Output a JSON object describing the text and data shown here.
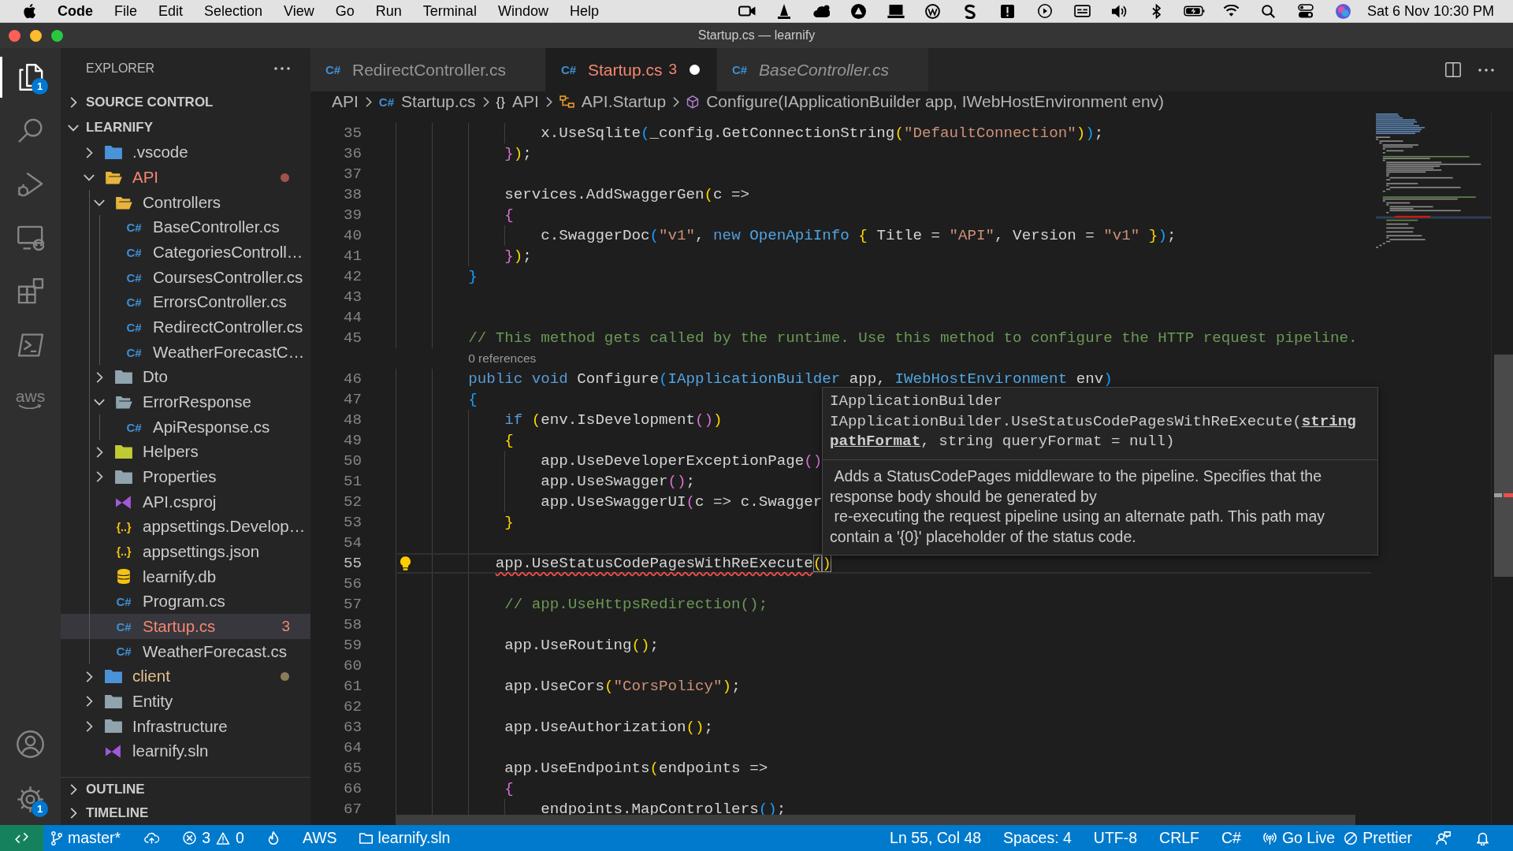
{
  "menu_bar": {
    "app": "Code",
    "menus": [
      "File",
      "Edit",
      "Selection",
      "View",
      "Go",
      "Run",
      "Terminal",
      "Window",
      "Help"
    ],
    "clock": "Sat 6 Nov 10:30 PM"
  },
  "window": {
    "title": "Startup.cs — learnify"
  },
  "activity_bar": {
    "items": [
      {
        "selected": true,
        "badge": "1"
      },
      {
        "selected": false
      },
      {
        "selected": false
      },
      {
        "selected": false
      },
      {
        "selected": false
      },
      {
        "selected": false
      },
      {
        "selected": false,
        "label": "aws"
      }
    ],
    "manage": {
      "badge": "1"
    }
  },
  "sidebar": {
    "title": "EXPLORER",
    "sections": [
      {
        "label": "SOURCE CONTROL",
        "expanded": false
      },
      {
        "label": "LEARNIFY",
        "expanded": true,
        "tree": [
          {
            "kind": "folder",
            "label": ".vscode",
            "color": "#4b93d8",
            "expanded": false,
            "selected": false,
            "errors": false,
            "modified": false
          },
          {
            "kind": "folder",
            "label": "API",
            "color": "#e9b43c",
            "expanded": true,
            "selected": false,
            "errors": true,
            "modified": false,
            "children": [
              {
                "kind": "folder",
                "label": "Controllers",
                "color": "#e9b43c",
                "expanded": true,
                "selected": false,
                "errors": false,
                "modified": false,
                "children": [
                  {
                    "kind": "csharp-file",
                    "glyph": "C#",
                    "label": "BaseController.cs",
                    "color": "#3f8fd2",
                    "selected": false,
                    "errors": false,
                    "modified": false
                  },
                  {
                    "kind": "csharp-file",
                    "glyph": "C#",
                    "label": "CategoriesControll…",
                    "color": "#3f8fd2",
                    "selected": false,
                    "errors": false,
                    "modified": false
                  },
                  {
                    "kind": "csharp-file",
                    "glyph": "C#",
                    "label": "CoursesController.cs",
                    "color": "#3f8fd2",
                    "selected": false,
                    "errors": false,
                    "modified": false
                  },
                  {
                    "kind": "csharp-file",
                    "glyph": "C#",
                    "label": "ErrorsController.cs",
                    "color": "#3f8fd2",
                    "selected": false,
                    "errors": false,
                    "modified": false
                  },
                  {
                    "kind": "csharp-file",
                    "glyph": "C#",
                    "label": "RedirectController.cs",
                    "color": "#3f8fd2",
                    "selected": false,
                    "errors": false,
                    "modified": false
                  },
                  {
                    "kind": "csharp-file",
                    "glyph": "C#",
                    "label": "WeatherForecastC…",
                    "color": "#3f8fd2",
                    "selected": false,
                    "errors": false,
                    "modified": false
                  }
                ]
              },
              {
                "kind": "folder",
                "label": "Dto",
                "color": "#90a4ae",
                "expanded": false,
                "selected": false,
                "errors": false,
                "modified": false
              },
              {
                "kind": "folder",
                "label": "ErrorResponse",
                "color": "#90a4ae",
                "expanded": true,
                "selected": false,
                "errors": false,
                "modified": false,
                "children": [
                  {
                    "kind": "csharp-file",
                    "glyph": "C#",
                    "label": "ApiResponse.cs",
                    "color": "#3f8fd2",
                    "selected": false,
                    "errors": false,
                    "modified": false
                  }
                ]
              },
              {
                "kind": "folder",
                "label": "Helpers",
                "color": "#c0ca33",
                "expanded": false,
                "selected": false,
                "errors": false,
                "modified": false
              },
              {
                "kind": "folder",
                "label": "Properties",
                "color": "#90a4ae",
                "expanded": false,
                "selected": false,
                "errors": false,
                "modified": false
              },
              {
                "kind": "vs-file",
                "label": "API.csproj",
                "color": "#a259d9",
                "selected": false,
                "errors": false,
                "modified": false
              },
              {
                "kind": "json-file",
                "glyph": "{..}",
                "label": "appsettings.Develop…",
                "color": "#f5c211",
                "selected": false,
                "errors": false,
                "modified": false
              },
              {
                "kind": "json-file",
                "glyph": "{..}",
                "label": "appsettings.json",
                "color": "#f5c211",
                "selected": false,
                "errors": false,
                "modified": false
              },
              {
                "kind": "db-file",
                "label": "learnify.db",
                "color": "#f5c211",
                "selected": false,
                "errors": false,
                "modified": false
              },
              {
                "kind": "csharp-file",
                "glyph": "C#",
                "label": "Program.cs",
                "color": "#3f8fd2",
                "selected": false,
                "errors": false,
                "modified": false
              },
              {
                "kind": "csharp-file",
                "glyph": "C#",
                "label": "Startup.cs",
                "color": "#3f8fd2",
                "selected": true,
                "errors": true,
                "modified": false,
                "badge": "3"
              },
              {
                "kind": "csharp-file",
                "glyph": "C#",
                "label": "WeatherForecast.cs",
                "color": "#3f8fd2",
                "selected": false,
                "errors": false,
                "modified": false
              }
            ]
          },
          {
            "kind": "folder",
            "label": "client",
            "color": "#4b93d8",
            "expanded": false,
            "selected": false,
            "errors": false,
            "modified": true
          },
          {
            "kind": "folder",
            "label": "Entity",
            "color": "#90a4ae",
            "expanded": false,
            "selected": false,
            "errors": false,
            "modified": false
          },
          {
            "kind": "folder",
            "label": "Infrastructure",
            "color": "#90a4ae",
            "expanded": false,
            "selected": false,
            "errors": false,
            "modified": false
          },
          {
            "kind": "vs-file",
            "label": "learnify.sln",
            "color": "#a259d9",
            "selected": false,
            "errors": false,
            "modified": false
          }
        ]
      },
      {
        "label": "OUTLINE",
        "expanded": false
      },
      {
        "label": "TIMELINE",
        "expanded": false
      }
    ]
  },
  "editor": {
    "tabs": [
      {
        "glyph": "C#",
        "label": "RedirectController.cs",
        "selected": false,
        "dirty": false,
        "preview": false,
        "errors": false
      },
      {
        "glyph": "C#",
        "label": "Startup.cs",
        "badge": "3",
        "selected": true,
        "dirty": true,
        "preview": false,
        "errors": true
      },
      {
        "glyph": "C#",
        "label": "BaseController.cs",
        "selected": false,
        "dirty": false,
        "preview": true,
        "errors": false
      }
    ],
    "breadcrumb": [
      {
        "kind": "folder",
        "label": "API"
      },
      {
        "kind": "csharp-file",
        "glyph": "C#",
        "label": "Startup.cs"
      },
      {
        "kind": "namespace",
        "glyph": "{}",
        "label": "API"
      },
      {
        "kind": "class",
        "label": "API.Startup"
      },
      {
        "kind": "method",
        "label": "Configure(IApplicationBuilder app, IWebHostEnvironment env)"
      }
    ],
    "lines": [
      {
        "kind": "code",
        "number": "35",
        "current": false,
        "lightbulb": false,
        "tokens": [
          {
            "kind": "plain",
            "text": "                x.UseSqlite"
          },
          {
            "kind": "bracket-3",
            "text": "("
          },
          {
            "kind": "plain",
            "text": "_config.GetConnectionString"
          },
          {
            "kind": "bracket-1",
            "text": "("
          },
          {
            "kind": "string",
            "text": "\"DefaultConnection\""
          },
          {
            "kind": "bracket-1",
            "text": ")"
          },
          {
            "kind": "bracket-3",
            "text": ")"
          },
          {
            "kind": "plain",
            "text": ";"
          }
        ]
      },
      {
        "kind": "code",
        "number": "36",
        "current": false,
        "lightbulb": false,
        "tokens": [
          {
            "kind": "bracket-2",
            "text": "            }"
          },
          {
            "kind": "bracket-1",
            "text": ")"
          },
          {
            "kind": "plain",
            "text": ";"
          }
        ]
      },
      {
        "kind": "code",
        "number": "37",
        "current": false,
        "lightbulb": false
      },
      {
        "kind": "code",
        "number": "38",
        "current": false,
        "lightbulb": false,
        "tokens": [
          {
            "kind": "plain",
            "text": "            services.AddSwaggerGen"
          },
          {
            "kind": "bracket-1",
            "text": "("
          },
          {
            "kind": "plain",
            "text": "c =>"
          }
        ]
      },
      {
        "kind": "code",
        "number": "39",
        "current": false,
        "lightbulb": false,
        "tokens": [
          {
            "kind": "bracket-2",
            "text": "            {"
          }
        ]
      },
      {
        "kind": "code",
        "number": "40",
        "current": false,
        "lightbulb": false,
        "tokens": [
          {
            "kind": "plain",
            "text": "                c.SwaggerDoc"
          },
          {
            "kind": "bracket-3",
            "text": "("
          },
          {
            "kind": "string",
            "text": "\"v1\""
          },
          {
            "kind": "plain",
            "text": ", "
          },
          {
            "kind": "keyword",
            "text": "new"
          },
          {
            "kind": "type",
            "text": " OpenApiInfo"
          },
          {
            "kind": "bracket-1",
            "text": " {"
          },
          {
            "kind": "plain",
            "text": " Title = "
          },
          {
            "kind": "string",
            "text": "\"API\""
          },
          {
            "kind": "plain",
            "text": ", Version = "
          },
          {
            "kind": "string",
            "text": "\"v1\""
          },
          {
            "kind": "bracket-1",
            "text": " }"
          },
          {
            "kind": "bracket-3",
            "text": ")"
          },
          {
            "kind": "plain",
            "text": ";"
          }
        ]
      },
      {
        "kind": "code",
        "number": "41",
        "current": false,
        "lightbulb": false,
        "tokens": [
          {
            "kind": "bracket-2",
            "text": "            }"
          },
          {
            "kind": "bracket-1",
            "text": ")"
          },
          {
            "kind": "plain",
            "text": ";"
          }
        ]
      },
      {
        "kind": "code",
        "number": "42",
        "current": false,
        "lightbulb": false,
        "tokens": [
          {
            "kind": "bracket-3",
            "text": "        }"
          }
        ]
      },
      {
        "kind": "code",
        "number": "43",
        "current": false,
        "lightbulb": false
      },
      {
        "kind": "code",
        "number": "44",
        "current": false,
        "lightbulb": false
      },
      {
        "kind": "code",
        "number": "45",
        "current": false,
        "lightbulb": false,
        "tokens": [
          {
            "kind": "comment",
            "text": "        // This method gets called by the runtime. Use this method to configure the HTTP request pipeline."
          }
        ]
      },
      {
        "kind": "codelens",
        "text": "0 references"
      },
      {
        "kind": "code",
        "number": "46",
        "current": false,
        "lightbulb": false,
        "tokens": [
          {
            "kind": "keyword",
            "text": "        public void"
          },
          {
            "kind": "plain",
            "text": " Configure"
          },
          {
            "kind": "bracket-3",
            "text": "("
          },
          {
            "kind": "type",
            "text": "IApplicationBuilder"
          },
          {
            "kind": "plain",
            "text": " app, "
          },
          {
            "kind": "type",
            "text": "IWebHostEnvironment"
          },
          {
            "kind": "plain",
            "text": " env"
          },
          {
            "kind": "bracket-3",
            "text": ")"
          }
        ]
      },
      {
        "kind": "code",
        "number": "47",
        "current": false,
        "lightbulb": false,
        "tokens": [
          {
            "kind": "bracket-3",
            "text": "        {"
          }
        ]
      },
      {
        "kind": "code",
        "number": "48",
        "current": false,
        "lightbulb": false,
        "tokens": [
          {
            "kind": "keyword",
            "text": "            if"
          },
          {
            "kind": "bracket-1",
            "text": " ("
          },
          {
            "kind": "plain",
            "text": "env.IsDevelopment"
          },
          {
            "kind": "bracket-2",
            "text": "("
          },
          {
            "kind": "bracket-2",
            "text": ")"
          },
          {
            "kind": "bracket-1",
            "text": ")"
          }
        ]
      },
      {
        "kind": "code",
        "number": "49",
        "current": false,
        "lightbulb": false,
        "tokens": [
          {
            "kind": "bracket-1",
            "text": "            {"
          }
        ]
      },
      {
        "kind": "code",
        "number": "50",
        "current": false,
        "lightbulb": false,
        "tokens": [
          {
            "kind": "plain",
            "text": "                app.UseDeveloperExceptionPage"
          },
          {
            "kind": "bracket-2",
            "text": "("
          },
          {
            "kind": "bracket-2",
            "text": ")"
          }
        ]
      },
      {
        "kind": "code",
        "number": "51",
        "current": false,
        "lightbulb": false,
        "tokens": [
          {
            "kind": "plain",
            "text": "                app.UseSwagger"
          },
          {
            "kind": "bracket-2",
            "text": "("
          },
          {
            "kind": "bracket-2",
            "text": ")"
          },
          {
            "kind": "plain",
            "text": ";"
          }
        ]
      },
      {
        "kind": "code",
        "number": "52",
        "current": false,
        "lightbulb": false,
        "tokens": [
          {
            "kind": "plain",
            "text": "                app.UseSwaggerUI"
          },
          {
            "kind": "bracket-2",
            "text": "("
          },
          {
            "kind": "plain",
            "text": "c => c.Swagger"
          }
        ]
      },
      {
        "kind": "code",
        "number": "53",
        "current": false,
        "lightbulb": false,
        "tokens": [
          {
            "kind": "bracket-1",
            "text": "            }"
          }
        ]
      },
      {
        "kind": "code",
        "number": "54",
        "current": false,
        "lightbulb": false
      },
      {
        "kind": "code",
        "number": "55",
        "current": true,
        "lightbulb": true,
        "tokens": [
          {
            "kind": "error",
            "text": "           app.UseStatusCodePagesWithReExecute"
          },
          {
            "kind": "bracket-match",
            "text": "("
          },
          {
            "kind": "bracket-match",
            "text": ")"
          }
        ]
      },
      {
        "kind": "code",
        "number": "56",
        "current": false,
        "lightbulb": false
      },
      {
        "kind": "code",
        "number": "57",
        "current": false,
        "lightbulb": false,
        "tokens": [
          {
            "kind": "comment",
            "text": "            // app.UseHttpsRedirection();"
          }
        ]
      },
      {
        "kind": "code",
        "number": "58",
        "current": false,
        "lightbulb": false
      },
      {
        "kind": "code",
        "number": "59",
        "current": false,
        "lightbulb": false,
        "tokens": [
          {
            "kind": "plain",
            "text": "            app.UseRouting"
          },
          {
            "kind": "bracket-1",
            "text": "("
          },
          {
            "kind": "bracket-1",
            "text": ")"
          },
          {
            "kind": "plain",
            "text": ";"
          }
        ]
      },
      {
        "kind": "code",
        "number": "60",
        "current": false,
        "lightbulb": false
      },
      {
        "kind": "code",
        "number": "61",
        "current": false,
        "lightbulb": false,
        "tokens": [
          {
            "kind": "plain",
            "text": "            app.UseCors"
          },
          {
            "kind": "bracket-1",
            "text": "("
          },
          {
            "kind": "string",
            "text": "\"CorsPolicy\""
          },
          {
            "kind": "bracket-1",
            "text": ")"
          },
          {
            "kind": "plain",
            "text": ";"
          }
        ]
      },
      {
        "kind": "code",
        "number": "62",
        "current": false,
        "lightbulb": false
      },
      {
        "kind": "code",
        "number": "63",
        "current": false,
        "lightbulb": false,
        "tokens": [
          {
            "kind": "plain",
            "text": "            app.UseAuthorization"
          },
          {
            "kind": "bracket-1",
            "text": "("
          },
          {
            "kind": "bracket-1",
            "text": ")"
          },
          {
            "kind": "plain",
            "text": ";"
          }
        ]
      },
      {
        "kind": "code",
        "number": "64",
        "current": false,
        "lightbulb": false
      },
      {
        "kind": "code",
        "number": "65",
        "current": false,
        "lightbulb": false,
        "tokens": [
          {
            "kind": "plain",
            "text": "            app.UseEndpoints"
          },
          {
            "kind": "bracket-1",
            "text": "("
          },
          {
            "kind": "plain",
            "text": "endpoints =>"
          }
        ]
      },
      {
        "kind": "code",
        "number": "66",
        "current": false,
        "lightbulb": false,
        "tokens": [
          {
            "kind": "bracket-2",
            "text": "            {"
          }
        ]
      },
      {
        "kind": "code",
        "number": "67",
        "current": false,
        "lightbulb": false,
        "tokens": [
          {
            "kind": "plain",
            "text": "                endpoints.MapControllers"
          },
          {
            "kind": "bracket-3",
            "text": "("
          },
          {
            "kind": "bracket-3",
            "text": ")"
          },
          {
            "kind": "plain",
            "text": ";"
          }
        ]
      }
    ],
    "hover": {
      "signature": "IApplicationBuilder IApplicationBuilder.UseStatusCodePagesWithReExecute(**string pathFormat**, string queryFormat = null)",
      "documentation": " Adds a StatusCodePages middleware to the pipeline. Specifies that the response body should be generated by\n re-executing the request pipeline using an alternate path. This path may contain a '{0}' placeholder of the status code."
    }
  },
  "status_bar": {
    "branch": "master*",
    "errors": "3",
    "warnings": "0",
    "aws": "AWS",
    "solution": "learnify.sln",
    "cursor": "Ln 55, Col 48",
    "indentation": "Spaces: 4",
    "encoding": "UTF-8",
    "eol": "CRLF",
    "language": "C#",
    "live_server": "Go Live",
    "formatter": "Prettier"
  }
}
